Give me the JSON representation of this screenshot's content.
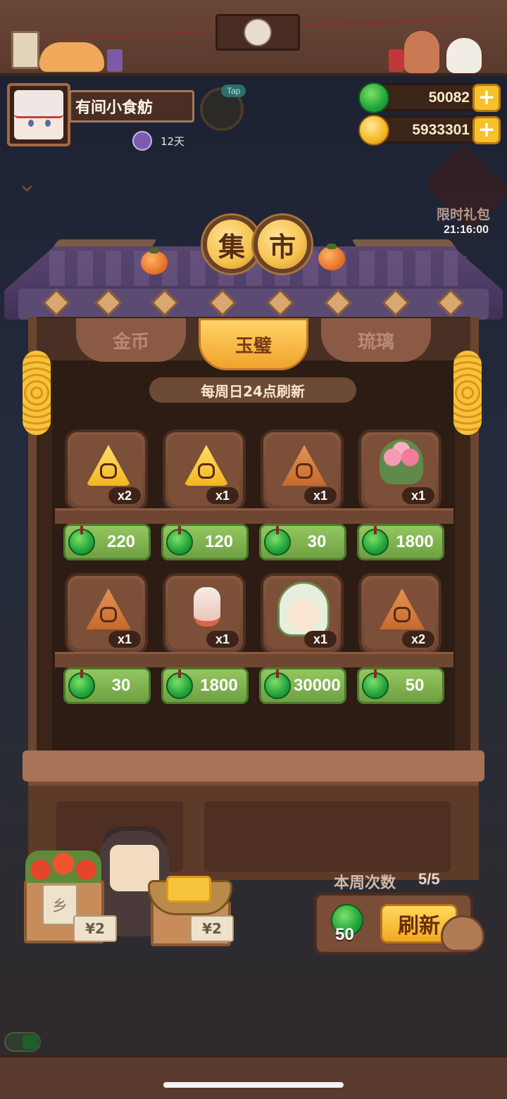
{
  "header": {
    "shop_name": "有间小食舫",
    "days": "12天",
    "tap_label": "Tap"
  },
  "currency": {
    "jade": "50082",
    "gold": "5933301",
    "plus": "+"
  },
  "limited_gift": {
    "label": "限时礼包",
    "timer": "21:16:00"
  },
  "market": {
    "title_chars": [
      "集",
      "市"
    ],
    "tabs": [
      {
        "label": "金币",
        "active": false
      },
      {
        "label": "玉璧",
        "active": true
      },
      {
        "label": "琉璃",
        "active": false
      }
    ],
    "refresh_note": "每周日24点刷新",
    "items": [
      {
        "icon": "gold-zongzi-icon",
        "qty": "x2",
        "price": "220"
      },
      {
        "icon": "gold-zongzi-icon",
        "qty": "x1",
        "price": "120"
      },
      {
        "icon": "bronze-zongzi-icon",
        "qty": "x1",
        "price": "30"
      },
      {
        "icon": "flower-bouquet-icon",
        "qty": "x1",
        "price": "1800"
      },
      {
        "icon": "bronze-zongzi-icon",
        "qty": "x1",
        "price": "30"
      },
      {
        "icon": "lantern-icon",
        "qty": "x1",
        "price": "1800"
      },
      {
        "icon": "character-icon",
        "qty": "x1",
        "price": "30000"
      },
      {
        "icon": "bronze-zongzi-icon",
        "qty": "x2",
        "price": "50"
      }
    ]
  },
  "stall": {
    "tag_left": "¥2",
    "tag_right": "¥2",
    "sign": "乡"
  },
  "refresh": {
    "week_label": "本周次数",
    "week_count": "5/5",
    "cost": "50",
    "button": "刷新"
  },
  "colors": {
    "jade": "#21a43a",
    "gold": "#f3b823",
    "price_button": "#7fb04f",
    "active_tab": "#f6bd45"
  }
}
